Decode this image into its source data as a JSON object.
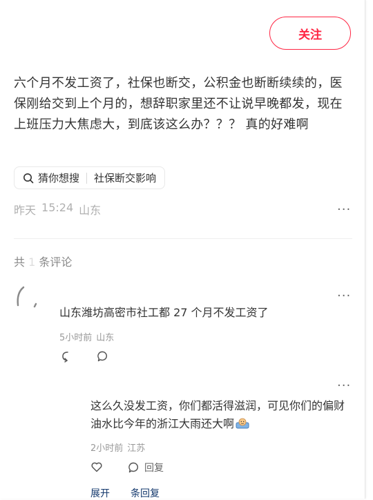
{
  "follow_button": "关注",
  "post": {
    "text": "六个月不发工资了，社保也断交，公积金也断断续续的，医保刚给交到上个月的，想辞职家里还不让说早晚都发，现在上班压力大焦虑大，到底该这么办？？？ 真的好难啊"
  },
  "search_chip": {
    "prefix": "猜你想搜",
    "keyword": "社保断交影响"
  },
  "post_meta": {
    "date": "昨天",
    "time": "15:24",
    "location": "山东"
  },
  "comments_header": {
    "prefix": "共",
    "count": "1",
    "suffix": "条评论"
  },
  "comments": [
    {
      "text": "山东潍坊高密市社工都 27 个月不发工资了",
      "time": "5小时前",
      "location": "山东"
    }
  ],
  "replies": [
    {
      "text": "这么久没发工资，你们都活得滋润，可见你们的偏财油水比今年的浙江大雨还大啊",
      "time": "2小时前",
      "location": "江苏",
      "reply_label": "回复"
    }
  ],
  "expand": {
    "label": "展开",
    "suffix": "条回复"
  },
  "colors": {
    "accent": "#ff2442",
    "meta_gray": "#b0b0b0",
    "link_blue": "#13386c"
  }
}
